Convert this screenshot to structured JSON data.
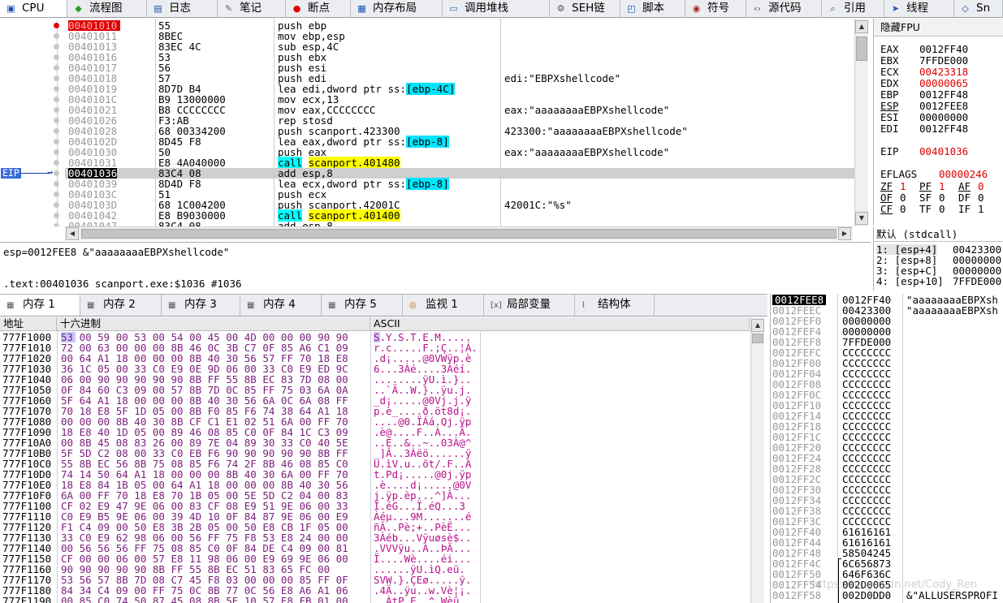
{
  "toolbar": {
    "tabs": [
      {
        "label": "CPU",
        "icon": "cpu-icon",
        "glyph": "▣"
      },
      {
        "label": "流程图",
        "icon": "graph-icon",
        "glyph": "◆"
      },
      {
        "label": "日志",
        "icon": "log-icon",
        "glyph": "▤"
      },
      {
        "label": "笔记",
        "icon": "notes-icon",
        "glyph": "✎"
      },
      {
        "label": "断点",
        "icon": "breakpoint-icon",
        "glyph": "●"
      },
      {
        "label": "内存布局",
        "icon": "memory-map-icon",
        "glyph": "▦"
      },
      {
        "label": "调用堆栈",
        "icon": "call-stack-icon",
        "glyph": "▭"
      },
      {
        "label": "SEH链",
        "icon": "seh-icon",
        "glyph": "⚙"
      },
      {
        "label": "脚本",
        "icon": "script-icon",
        "glyph": "◰"
      },
      {
        "label": "符号",
        "icon": "symbols-icon",
        "glyph": "◉"
      },
      {
        "label": "源代码",
        "icon": "source-icon",
        "glyph": "‹›"
      },
      {
        "label": "引用",
        "icon": "references-icon",
        "glyph": "⌕"
      },
      {
        "label": "线程",
        "icon": "threads-icon",
        "glyph": "➤"
      },
      {
        "label": "Sn",
        "icon": "snowman-icon",
        "glyph": "◇"
      }
    ]
  },
  "disasm": {
    "rows": [
      {
        "addr": "00401010",
        "bytes": "55",
        "instr": "push ebp",
        "comment": ""
      },
      {
        "addr": "00401011",
        "bytes": "8BEC",
        "instr": "mov ebp,esp",
        "comment": ""
      },
      {
        "addr": "00401013",
        "bytes": "83EC 4C",
        "instr": "sub esp,4C",
        "comment": ""
      },
      {
        "addr": "00401016",
        "bytes": "53",
        "instr": "push ebx",
        "comment": ""
      },
      {
        "addr": "00401017",
        "bytes": "56",
        "instr": "push esi",
        "comment": ""
      },
      {
        "addr": "00401018",
        "bytes": "57",
        "instr": "push edi",
        "comment": "edi:\"EBPXshellcode\""
      },
      {
        "addr": "00401019",
        "bytes": "8D7D B4",
        "instr_pre": "lea edi,dword ptr ss:",
        "instr_br": "[ebp-4C]",
        "comment": ""
      },
      {
        "addr": "0040101C",
        "bytes": "B9 13000000",
        "instr": "mov ecx,13",
        "comment": ""
      },
      {
        "addr": "00401021",
        "bytes": "B8 CCCCCCCC",
        "instr": "mov eax,CCCCCCCC",
        "comment": "eax:\"aaaaaaaaEBPXshellcode\""
      },
      {
        "addr": "00401026",
        "bytes": "F3:AB",
        "instr": "rep stosd",
        "comment": ""
      },
      {
        "addr": "00401028",
        "bytes": "68 00334200",
        "instr": "push scanport.423300",
        "comment": "423300:\"aaaaaaaaEBPXshellcode\""
      },
      {
        "addr": "0040102D",
        "bytes": "8D45 F8",
        "instr_pre": "lea eax,dword ptr ss:",
        "instr_br": "[ebp-8]",
        "comment": ""
      },
      {
        "addr": "00401030",
        "bytes": "50",
        "instr": "push eax",
        "comment": "eax:\"aaaaaaaaEBPXshellcode\""
      },
      {
        "addr": "00401031",
        "bytes": "E8 4A040000",
        "call": "call",
        "target": "scanport.401480",
        "comment": ""
      },
      {
        "addr": "00401036",
        "bytes": "83C4 08",
        "instr": "add esp,8",
        "comment": ""
      },
      {
        "addr": "00401039",
        "bytes": "8D4D F8",
        "instr_pre": "lea ecx,dword ptr ss:",
        "instr_br": "[ebp-8]",
        "comment": ""
      },
      {
        "addr": "0040103C",
        "bytes": "51",
        "instr": "push ecx",
        "comment": ""
      },
      {
        "addr": "0040103D",
        "bytes": "68 1C004200",
        "instr": "push scanport.42001C",
        "comment": "42001C:\"%s\""
      },
      {
        "addr": "00401042",
        "bytes": "E8 B9030000",
        "call": "call",
        "target": "scanport.401400",
        "comment": ""
      },
      {
        "addr": "00401047",
        "bytes": "83C4 08",
        "instr": "add esp,8",
        "comment": ""
      }
    ],
    "eip_label": "EIP",
    "eip_arrow": "→"
  },
  "info": {
    "line1": "esp=0012FEE8 &\"aaaaaaaaEBPXshellcode\"",
    "line2": ".text:00401036 scanport.exe:$1036 #1036"
  },
  "registers": {
    "title": "隐藏FPU",
    "general": [
      {
        "name": "EAX",
        "value": "0012FF40",
        "changed": false
      },
      {
        "name": "EBX",
        "value": "7FFDE000",
        "changed": false
      },
      {
        "name": "ECX",
        "value": "00423318",
        "changed": true
      },
      {
        "name": "EDX",
        "value": "00000065",
        "changed": true
      },
      {
        "name": "EBP",
        "value": "0012FF48",
        "changed": false
      },
      {
        "name": "ESP",
        "value": "0012FEE8",
        "changed": false
      },
      {
        "name": "ESI",
        "value": "00000000",
        "changed": false
      },
      {
        "name": "EDI",
        "value": "0012FF48",
        "changed": false
      }
    ],
    "eip": {
      "name": "EIP",
      "value": "00401036"
    },
    "eflags": {
      "name": "EFLAGS",
      "value": "00000246"
    },
    "flags": [
      [
        {
          "n": "ZF",
          "v": "1",
          "c": true
        },
        {
          "n": "PF",
          "v": "1",
          "c": true
        },
        {
          "n": "AF",
          "v": "0",
          "c": true
        }
      ],
      [
        {
          "n": "OF",
          "v": "0",
          "c": false
        },
        {
          "n": "SF",
          "v": "0",
          "c": false
        },
        {
          "n": "DF",
          "v": "0",
          "c": false
        }
      ],
      [
        {
          "n": "CF",
          "v": "0",
          "c": false
        },
        {
          "n": "TF",
          "v": "0",
          "c": false
        },
        {
          "n": "IF",
          "v": "1",
          "c": false
        }
      ]
    ]
  },
  "callconv": {
    "title": "默认 (stdcall)",
    "rows": [
      {
        "k": "1: [esp+4]",
        "v": "00423300"
      },
      {
        "k": "2: [esp+8]",
        "v": "00000000"
      },
      {
        "k": "3: [esp+C]",
        "v": "00000000"
      },
      {
        "k": "4: [esp+10]",
        "v": "7FFDE000"
      }
    ]
  },
  "memtabs": [
    {
      "label": "内存 1",
      "icon": "memory-icon"
    },
    {
      "label": "内存 2",
      "icon": "memory-icon"
    },
    {
      "label": "内存 3",
      "icon": "memory-icon"
    },
    {
      "label": "内存 4",
      "icon": "memory-icon"
    },
    {
      "label": "内存 5",
      "icon": "memory-icon"
    },
    {
      "label": "监视 1",
      "icon": "watch-icon"
    },
    {
      "label": "局部变量",
      "icon": "locals-icon"
    },
    {
      "label": "结构体",
      "icon": "struct-icon"
    }
  ],
  "dump": {
    "headers": {
      "addr": "地址",
      "hex": "十六进制",
      "ascii": "ASCII"
    },
    "rows": [
      {
        "a": "777F1000",
        "h": "53 00 59 00 53 00 54 00 45 00 4D 00 00 00 90 90",
        "s": "S.Y.S.T.E.M....."
      },
      {
        "a": "777F1010",
        "h": "72 00 63 00 00 00 8B 46 0C 3B C7 0F 85 A6 C1 09",
        "s": "r.c.....F.;Ç..¦Á."
      },
      {
        "a": "777F1020",
        "h": "00 64 A1 18 00 00 00 8B 40 30 56 57 FF 70 18 E8",
        "s": ".d¡.....@0VWÿp.è"
      },
      {
        "a": "777F1030",
        "h": "36 1C 05 00 33 C0 E9 0E 9D 06 00 33 C0 E9 ED 9C",
        "s": "6...3Àé....3Àéí."
      },
      {
        "a": "777F1040",
        "h": "06 00 90 90 90 90 90 8B FF 55 8B EC 83 7D 08 00",
        "s": "........ÿU.ì.}.."
      },
      {
        "a": "777F1050",
        "h": "0F 84 60 C3 09 00 57 8B 7D 0C 85 FF 75 03 6A 0A",
        "s": "..`Ã..W.}..ÿu.j."
      },
      {
        "a": "777F1060",
        "h": "5F 64 A1 18 00 00 00 8B 40 30 56 6A 0C 6A 08 FF",
        "s": "_d¡.....@0Vj.j.ÿ"
      },
      {
        "a": "777F1070",
        "h": "70 18 E8 5F 1D 05 00 8B F0 85 F6 74 38 64 A1 18",
        "s": "p.è_....ð.öt8d¡."
      },
      {
        "a": "777F1080",
        "h": "00 00 00 8B 40 30 8B CF C1 E1 02 51 6A 00 FF 70",
        "s": "....@0.ÏÁá.Qj.ÿp"
      },
      {
        "a": "777F1090",
        "h": "18 E8 40 1D 05 00 89 46 08 85 C0 0F 84 1C C3 09",
        "s": ".è@....F..À...Ã."
      },
      {
        "a": "777F10A0",
        "h": "00 8B 45 08 83 26 00 89 7E 04 89 30 33 C0 40 5E",
        "s": "..E..&..~..03À@^"
      },
      {
        "a": "777F10B0",
        "h": "5F 5D C2 08 00 33 C0 EB F6 90 90 90 90 90 8B FF",
        "s": "_]Â..3Àëö......ÿ"
      },
      {
        "a": "777F10C0",
        "h": "55 8B EC 56 8B 75 08 85 F6 74 2F 8B 46 08 85 C0",
        "s": "U.ìV.u..öt/.F..À"
      },
      {
        "a": "777F10D0",
        "h": "74 14 50 64 A1 18 00 00 00 8B 40 30 6A 00 FF 70",
        "s": "t.Pd¡.....@0j.ÿp"
      },
      {
        "a": "777F10E0",
        "h": "18 E8 84 1B 05 00 64 A1 18 00 00 00 8B 40 30 56",
        "s": ".è....d¡.....@0V"
      },
      {
        "a": "777F10F0",
        "h": "6A 00 FF 70 18 E8 70 1B 05 00 5E 5D C2 04 00 83",
        "s": "j.ÿp.èp...^]Â..."
      },
      {
        "a": "777F1100",
        "h": "CF 02 E9 47 9E 06 00 83 CF 08 E9 51 9E 06 00 33",
        "s": "Ï.éG...Ï.éQ...3"
      },
      {
        "a": "777F1110",
        "h": "C0 E9 B5 9E 06 00 39 4D 10 0F 84 87 9E 06 00 E9",
        "s": "Àéµ...9M.......é"
      },
      {
        "a": "777F1120",
        "h": "F1 C4 09 00 50 E8 3B 2B 05 00 50 E8 CB 1F 05 00",
        "s": "ñÄ..Pè;+..PèË..."
      },
      {
        "a": "777F1130",
        "h": "33 C0 E9 62 98 06 00 56 FF 75 F8 53 E8 24 00 00",
        "s": "3Àéb...Vÿuøsè$.."
      },
      {
        "a": "777F1140",
        "h": "00 56 56 56 FF 75 08 85 C0 0F 84 DE C4 09 00 81",
        "s": ".VVVÿu..À..ÞÄ..."
      },
      {
        "a": "777F1150",
        "h": "CF 00 00 06 00 57 E8 11 98 06 00 E9 69 9E 06 00",
        "s": "Ï....Wè....éi..."
      },
      {
        "a": "777F1160",
        "h": "90 90 90 90 90 8B FF 55 8B EC 51 83 65 FC 00",
        "s": "......ÿU.ìQ.eü."
      },
      {
        "a": "777F1170",
        "h": "53 56 57 8B 7D 08 C7 45 F8 03 00 00 00 85 FF 0F",
        "s": "SVW.}.ÇEø.....ÿ."
      },
      {
        "a": "777F1180",
        "h": "84 34 C4 09 00 FF 75 0C 8B 77 0C 56 E8 A6 A1 06",
        "s": ".4Ä..ÿu..w.Vè¦¡."
      },
      {
        "a": "777F1190",
        "h": "00 85 C0 74 50 87 45 08 8B 5E 10 57 E8 FB 01 00",
        "s": "..ÀtP.E..^.Wèû.."
      }
    ]
  },
  "stack": {
    "rows": [
      {
        "a": "0012FEE8",
        "v": "0012FF40",
        "c": "\"aaaaaaaaEBPXsh",
        "sel": true
      },
      {
        "a": "0012FEEC",
        "v": "00423300",
        "c": "\"aaaaaaaaEBPXsh"
      },
      {
        "a": "0012FEF0",
        "v": "00000000",
        "c": ""
      },
      {
        "a": "0012FEF4",
        "v": "00000000",
        "c": ""
      },
      {
        "a": "0012FEF8",
        "v": "7FFDE000",
        "c": ""
      },
      {
        "a": "0012FEFC",
        "v": "CCCCCCCC",
        "c": ""
      },
      {
        "a": "0012FF00",
        "v": "CCCCCCCC",
        "c": ""
      },
      {
        "a": "0012FF04",
        "v": "CCCCCCCC",
        "c": ""
      },
      {
        "a": "0012FF08",
        "v": "CCCCCCCC",
        "c": ""
      },
      {
        "a": "0012FF0C",
        "v": "CCCCCCCC",
        "c": ""
      },
      {
        "a": "0012FF10",
        "v": "CCCCCCCC",
        "c": ""
      },
      {
        "a": "0012FF14",
        "v": "CCCCCCCC",
        "c": ""
      },
      {
        "a": "0012FF18",
        "v": "CCCCCCCC",
        "c": ""
      },
      {
        "a": "0012FF1C",
        "v": "CCCCCCCC",
        "c": ""
      },
      {
        "a": "0012FF20",
        "v": "CCCCCCCC",
        "c": ""
      },
      {
        "a": "0012FF24",
        "v": "CCCCCCCC",
        "c": ""
      },
      {
        "a": "0012FF28",
        "v": "CCCCCCCC",
        "c": ""
      },
      {
        "a": "0012FF2C",
        "v": "CCCCCCCC",
        "c": ""
      },
      {
        "a": "0012FF30",
        "v": "CCCCCCCC",
        "c": ""
      },
      {
        "a": "0012FF34",
        "v": "CCCCCCCC",
        "c": ""
      },
      {
        "a": "0012FF38",
        "v": "CCCCCCCC",
        "c": ""
      },
      {
        "a": "0012FF3C",
        "v": "CCCCCCCC",
        "c": ""
      },
      {
        "a": "0012FF40",
        "v": "61616161",
        "c": ""
      },
      {
        "a": "0012FF44",
        "v": "61616161",
        "c": ""
      },
      {
        "a": "0012FF48",
        "v": "58504245",
        "c": ""
      },
      {
        "a": "0012FF4C",
        "v": "6C656873",
        "c": ""
      },
      {
        "a": "0012FF50",
        "v": "646F636C",
        "c": ""
      },
      {
        "a": "0012FF54",
        "v": "002D0065",
        "c": ""
      },
      {
        "a": "0012FF58",
        "v": "002D0DD0",
        "c": "&\"ALLUSERSPROFI"
      }
    ]
  },
  "watermark": "https://blog.csdn.net/Cody_Ren"
}
